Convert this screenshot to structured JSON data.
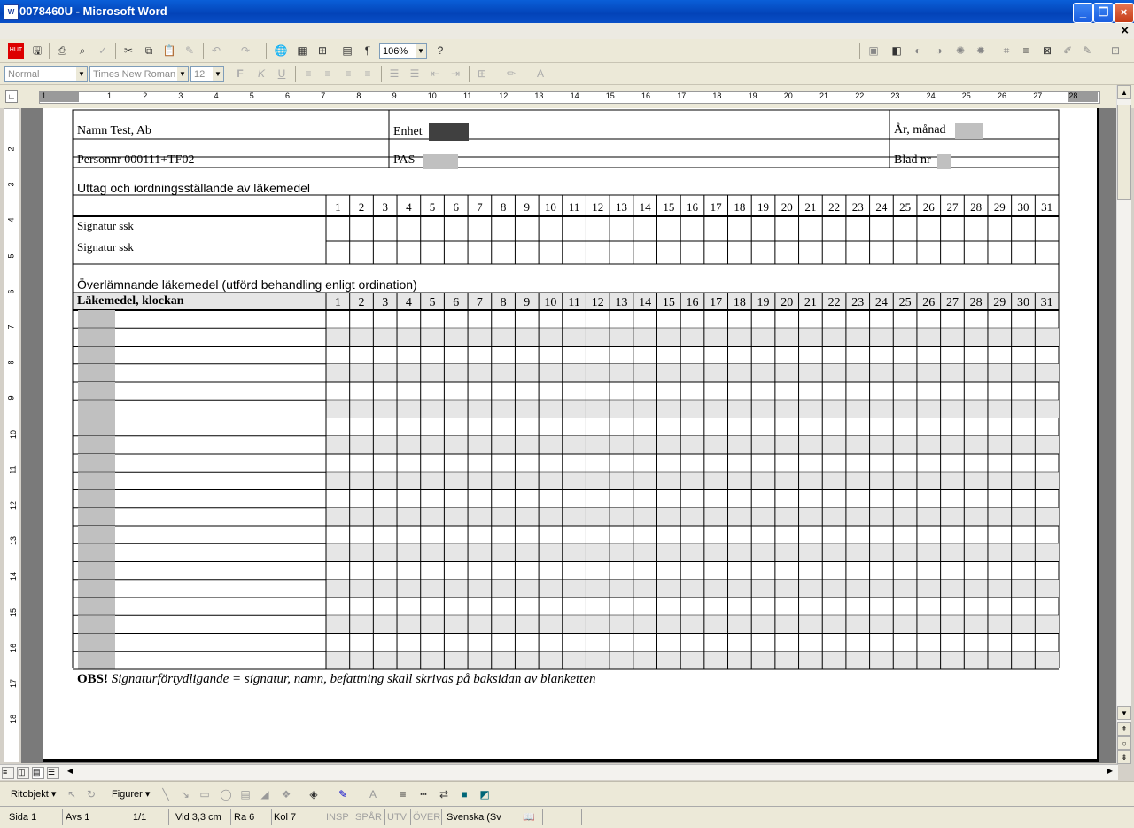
{
  "window": {
    "title": "0078460U - Microsoft Word",
    "icon": "word-doc-icon"
  },
  "toolbar": {
    "zoom": "106%",
    "style": "Normal",
    "font": "Times New Roman",
    "size": "12"
  },
  "ruler": {
    "numbers": [
      "1",
      "1",
      "2",
      "3",
      "4",
      "5",
      "6",
      "7",
      "8",
      "9",
      "10",
      "11",
      "12",
      "13",
      "14",
      "15",
      "16",
      "17",
      "18",
      "19",
      "20",
      "21",
      "22",
      "23",
      "24",
      "25",
      "26",
      "27",
      "28"
    ],
    "vnumbers": [
      "2",
      "3",
      "4",
      "5",
      "6",
      "7",
      "8",
      "9",
      "10",
      "11",
      "12",
      "13",
      "14",
      "15",
      "16",
      "17",
      "18"
    ]
  },
  "form": {
    "name_label": "Namn Test, Ab",
    "enhet_label": "Enhet",
    "year_label": "År, månad",
    "personnr_label": "Personnr 000111+TF02",
    "pas_label": "PAS",
    "blad_label": "Blad nr",
    "section1_title": "Uttag och iordningsställande av läkemedel",
    "sig1": "Signatur ssk",
    "sig2": "Signatur ssk",
    "section2_title": "Överlämnande läkemedel (utförd behandling enligt ordination)",
    "med_header": "Läkemedel, klockan",
    "days": [
      "1",
      "2",
      "3",
      "4",
      "5",
      "6",
      "7",
      "8",
      "9",
      "10",
      "11",
      "12",
      "13",
      "14",
      "15",
      "16",
      "17",
      "18",
      "19",
      "20",
      "21",
      "22",
      "23",
      "24",
      "25",
      "26",
      "27",
      "28",
      "29",
      "30",
      "31"
    ],
    "footer_bold": "OBS!",
    "footer_italic": "Signaturförtydligande = signatur, namn, befattning skall skrivas på baksidan av blanketten"
  },
  "drawbar": {
    "draw_label": "Ritobjekt",
    "shapes_label": "Figurer"
  },
  "status": {
    "page": "Sida  1",
    "section": "Avs  1",
    "pages": "1/1",
    "at": "Vid  3,3 cm",
    "line": "Ra  6",
    "col": "Kol  7",
    "rec": "INSP",
    "trk": "SPÅR",
    "ext": "UTV",
    "ovr": "ÖVER",
    "lang": "Svenska (Sv"
  }
}
